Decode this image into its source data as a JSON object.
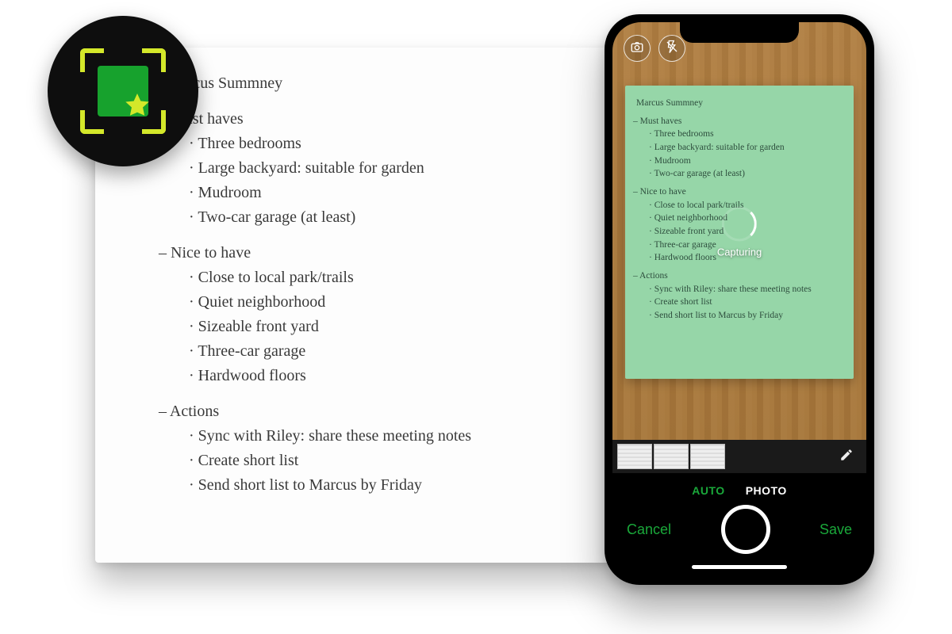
{
  "note": {
    "title": "Marcus Summney",
    "sections": [
      {
        "heading": "– Must haves",
        "items": [
          "Three bedrooms",
          "Large backyard: suitable for garden",
          "Mudroom",
          "Two-car garage (at least)"
        ]
      },
      {
        "heading": "– Nice to have",
        "items": [
          "Close to local park/trails",
          "Quiet neighborhood",
          "Sizeable front yard",
          "Three-car garage",
          "Hardwood floors"
        ]
      },
      {
        "heading": "– Actions",
        "items": [
          "Sync with Riley: share these meeting notes",
          "Create short list",
          "Send short list to Marcus by Friday"
        ]
      }
    ]
  },
  "phone": {
    "capturing_label": "Capturing",
    "modes": {
      "auto": "AUTO",
      "photo": "PHOTO"
    },
    "cancel": "Cancel",
    "save": "Save",
    "icons": {
      "camera": "camera-icon",
      "flash_off": "flash-off-icon",
      "edit": "pencil-icon"
    }
  },
  "badge": {
    "name": "scan-star-logo"
  },
  "colors": {
    "accent_green": "#1aa83a",
    "lime": "#d4e82a",
    "logo_green": "#17a22d",
    "sticky": "#96d6a8"
  }
}
